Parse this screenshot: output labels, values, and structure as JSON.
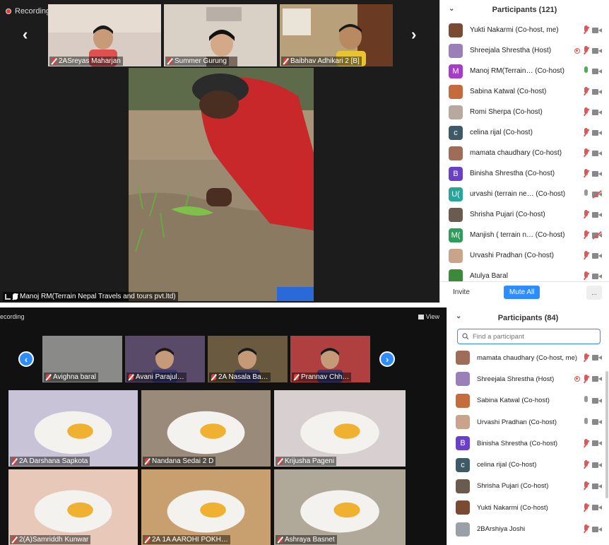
{
  "top": {
    "recording_label": "Recording",
    "thumbnails": [
      {
        "name": "2ASreyas Maharjan",
        "bg": "#d8ccc4"
      },
      {
        "name": "Summer Gurung",
        "bg": "#d9d0c6"
      },
      {
        "name": "Baibhav Adhikari 2 [B]",
        "bg": "#b8a07a"
      }
    ],
    "main_speaker_label": "Manoj RM(Terrain Nepal Travels and tours pvt.ltd)",
    "participants_title": "Participants (121)",
    "participants": [
      {
        "name": "Yukti Nakarmi (Co-host, me)",
        "avatar_letter": "",
        "avatar_color": "#7a4a32",
        "mic": "muted",
        "cam": "on",
        "rec": false
      },
      {
        "name": "Shreejala Shrestha (Host)",
        "avatar_letter": "",
        "avatar_color": "#9b7fb8",
        "mic": "muted",
        "cam": "on",
        "rec": true
      },
      {
        "name": "Manoj RM(Terrain… (Co-host)",
        "avatar_letter": "M",
        "avatar_color": "#a63cc9",
        "mic": "on",
        "cam": "on",
        "rec": false
      },
      {
        "name": "Sabina Katwal (Co-host)",
        "avatar_letter": "",
        "avatar_color": "#c56b3d",
        "mic": "muted",
        "cam": "on",
        "rec": false
      },
      {
        "name": "Romi Sherpa (Co-host)",
        "avatar_letter": "",
        "avatar_color": "#b7a8a0",
        "mic": "muted",
        "cam": "on",
        "rec": false
      },
      {
        "name": "celina rijal (Co-host)",
        "avatar_letter": "c",
        "avatar_color": "#3e5a66",
        "mic": "muted",
        "cam": "on",
        "rec": false
      },
      {
        "name": "mamata chaudhary (Co-host)",
        "avatar_letter": "",
        "avatar_color": "#a06c5a",
        "mic": "muted",
        "cam": "on",
        "rec": false
      },
      {
        "name": "Binisha Shrestha (Co-host)",
        "avatar_letter": "B",
        "avatar_color": "#6a3fc9",
        "mic": "muted",
        "cam": "on",
        "rec": false
      },
      {
        "name": "urvashi (terrain ne… (Co-host)",
        "avatar_letter": "U(",
        "avatar_color": "#26a69a",
        "mic": "idle",
        "cam": "off",
        "rec": false
      },
      {
        "name": "Shrisha Pujari (Co-host)",
        "avatar_letter": "",
        "avatar_color": "#6b5a4e",
        "mic": "muted",
        "cam": "on",
        "rec": false
      },
      {
        "name": "Manjish ( terrain n… (Co-host)",
        "avatar_letter": "M(",
        "avatar_color": "#2e9d5b",
        "mic": "muted",
        "cam": "off",
        "rec": false
      },
      {
        "name": "Urvashi Pradhan (Co-host)",
        "avatar_letter": "",
        "avatar_color": "#c9a48a",
        "mic": "muted",
        "cam": "on",
        "rec": false
      },
      {
        "name": "Atulya Baral",
        "avatar_letter": "",
        "avatar_color": "#3a8a3a",
        "mic": "muted",
        "cam": "on",
        "rec": false
      }
    ],
    "invite_label": "Invite",
    "mute_all_label": "Mute All",
    "more_label": "..."
  },
  "bottom": {
    "recording_label": "ecording",
    "view_label": "View",
    "thumbnails": [
      {
        "name": "Avighna baral",
        "bg": "#8a8a88"
      },
      {
        "name": "Avani Parajul…",
        "bg": "#5a4a6a"
      },
      {
        "name": "2A Nasala Ba…",
        "bg": "#6a5a40"
      },
      {
        "name": "Prannav Chh…",
        "bg": "#b04040"
      }
    ],
    "grid": [
      {
        "name": "2A Darshana Sapkota",
        "bg": "#c9c3d8"
      },
      {
        "name": "Nandana Sedai 2 D",
        "bg": "#9a8a7a"
      },
      {
        "name": "Krijusha Pageni",
        "bg": "#d8d0d0"
      },
      {
        "name": "2(A)Samriddh Kunwar",
        "bg": "#e8c8b8"
      },
      {
        "name": "2A 1A AAROHI POKH…",
        "bg": "#c8a070"
      },
      {
        "name": "Ashraya Basnet",
        "bg": "#b0a898"
      }
    ],
    "participants_title": "Participants (84)",
    "search_placeholder": "Find a participant",
    "participants": [
      {
        "name": "mamata chaudhary (Co-host, me)",
        "avatar_letter": "",
        "avatar_color": "#a06c5a",
        "mic": "muted",
        "cam": "on",
        "rec": false
      },
      {
        "name": "Shreejala Shrestha (Host)",
        "avatar_letter": "",
        "avatar_color": "#9b7fb8",
        "mic": "muted",
        "cam": "on",
        "rec": true
      },
      {
        "name": "Sabina Katwal (Co-host)",
        "avatar_letter": "",
        "avatar_color": "#c56b3d",
        "mic": "idle",
        "cam": "on",
        "rec": false
      },
      {
        "name": "Urvashi Pradhan (Co-host)",
        "avatar_letter": "",
        "avatar_color": "#c9a48a",
        "mic": "idle",
        "cam": "on",
        "rec": false
      },
      {
        "name": "Binisha Shrestha (Co-host)",
        "avatar_letter": "B",
        "avatar_color": "#6a3fc9",
        "mic": "muted",
        "cam": "on",
        "rec": false
      },
      {
        "name": "celina rijal (Co-host)",
        "avatar_letter": "c",
        "avatar_color": "#3e5a66",
        "mic": "muted",
        "cam": "on",
        "rec": false
      },
      {
        "name": "Shrisha Pujari (Co-host)",
        "avatar_letter": "",
        "avatar_color": "#6b5a4e",
        "mic": "muted",
        "cam": "on",
        "rec": false
      },
      {
        "name": "Yukti Nakarmi (Co-host)",
        "avatar_letter": "",
        "avatar_color": "#7a4a32",
        "mic": "muted",
        "cam": "on",
        "rec": false
      },
      {
        "name": "2BArshiya Joshi",
        "avatar_letter": "",
        "avatar_color": "#9aa0a6",
        "mic": "muted",
        "cam": "on",
        "rec": false
      }
    ]
  }
}
